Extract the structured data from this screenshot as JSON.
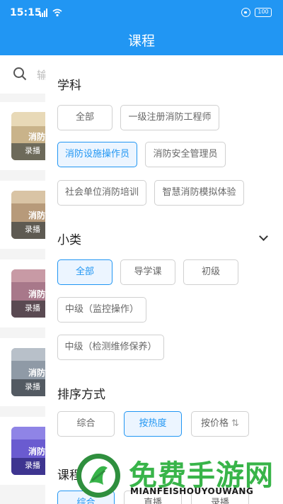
{
  "status_bar": {
    "time": "15:15",
    "battery": "100"
  },
  "header": {
    "title": "课程"
  },
  "background_page": {
    "search_placeholder": "输",
    "cards": [
      {
        "title": "消防",
        "badge": "录播",
        "thumb_color": "#c9b38a"
      },
      {
        "title": "消防",
        "badge": "录播",
        "thumb_color": "#b79a7a"
      },
      {
        "title": "消防",
        "badge": "录播",
        "thumb_color": "#a8788a"
      },
      {
        "title": "消防",
        "badge": "录播",
        "thumb_color": "#8f9aa6"
      },
      {
        "title": "消防",
        "badge": "录播",
        "thumb_color": "#6a5bd0"
      }
    ]
  },
  "filter_panel": {
    "subject": {
      "title": "学科",
      "options": [
        "全部",
        "一级注册消防工程师",
        "消防设施操作员",
        "消防安全管理员",
        "社会单位消防培训",
        "智慧消防模拟体验"
      ],
      "selected": "消防设施操作员"
    },
    "subcategory": {
      "title": "小类",
      "options": [
        "全部",
        "导学课",
        "初级",
        "中级（监控操作）",
        "中级（检测维修保养）"
      ],
      "selected": "全部"
    },
    "sort": {
      "title": "排序方式",
      "options": [
        "综合",
        "按热度",
        "按价格"
      ],
      "price_sort_glyph": "⇅",
      "selected": "按热度"
    },
    "course_type": {
      "title": "课程",
      "options": [
        "综合",
        "直播",
        "录播"
      ],
      "selected": "综合"
    }
  },
  "watermark": {
    "text": "免费手游网",
    "subtext": "MIANFEISHOUYOUWANG"
  },
  "colors": {
    "accent": "#2196f3",
    "accent_bg": "#ecf5ff",
    "watermark_green": "#38b449"
  }
}
